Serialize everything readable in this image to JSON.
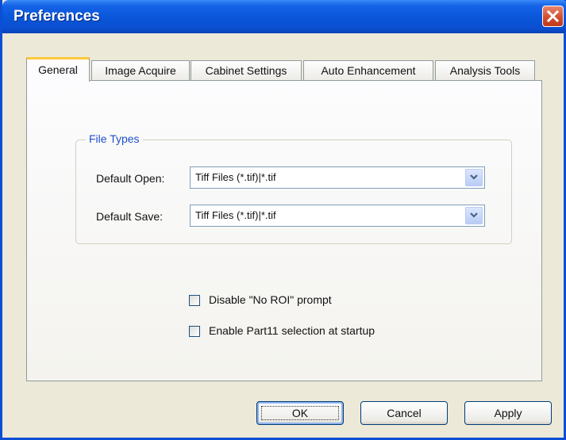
{
  "window": {
    "title": "Preferences",
    "close_icon": "close-icon"
  },
  "tabs": [
    {
      "label": "General",
      "active": true
    },
    {
      "label": "Image Acquire",
      "active": false
    },
    {
      "label": "Cabinet Settings",
      "active": false
    },
    {
      "label": "Auto Enhancement",
      "active": false
    },
    {
      "label": "Analysis Tools",
      "active": false
    }
  ],
  "file_types": {
    "legend": "File Types",
    "default_open_label": "Default Open:",
    "default_open_value": "Tiff Files (*.tif)|*.tif",
    "default_save_label": "Default Save:",
    "default_save_value": "Tiff Files (*.tif)|*.tif"
  },
  "options": [
    {
      "label": "Disable \"No ROI\" prompt",
      "checked": false
    },
    {
      "label": "Enable Part11 selection at startup",
      "checked": false
    }
  ],
  "buttons": {
    "ok": "OK",
    "cancel": "Cancel",
    "apply": "Apply"
  },
  "colors": {
    "titlebar": "#0a55d8",
    "active_tab_accent": "#ffc83c",
    "group_legend": "#1f4fd0"
  }
}
